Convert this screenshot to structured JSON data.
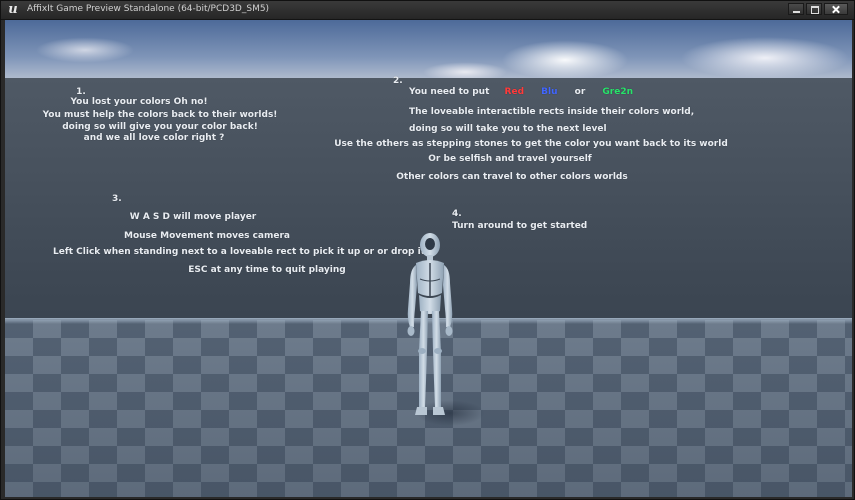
{
  "window": {
    "title": "AffixIt Game Preview Standalone (64-bit/PCD3D_SM5)",
    "logo_icon": "unreal-engine-logo",
    "logo_glyph": "u"
  },
  "instructions": {
    "section1": {
      "number": "1.",
      "lines": [
        "You lost your colors Oh no!",
        "You must help the colors back to their worlds!",
        "doing so will give you your color back!",
        "and we all love color right ?"
      ]
    },
    "section2": {
      "number": "2.",
      "intro": "You need to put",
      "color_red": "Red",
      "color_blue": "Blu",
      "or_word": "or",
      "color_green": "Gre2n",
      "lines": [
        "The loveable interactible rects inside their colors world,",
        "doing so will take you to the next level",
        "Use the others as stepping stones to get the color you want back to its world",
        "Or be selfish and travel yourself",
        "Other colors can travel to other colors worlds"
      ]
    },
    "section3": {
      "number": "3.",
      "lines": [
        "W A S D will move player",
        "Mouse Movement moves camera",
        "Left Click when standing next to a loveable rect to pick it up or or drop it",
        "ESC at any time to quit playing"
      ]
    },
    "section4": {
      "number": "4.",
      "lines": [
        "Turn around to get started"
      ]
    }
  },
  "colors": {
    "red": "#ff3b3b",
    "blue": "#4166ff",
    "green": "#27e36a"
  }
}
